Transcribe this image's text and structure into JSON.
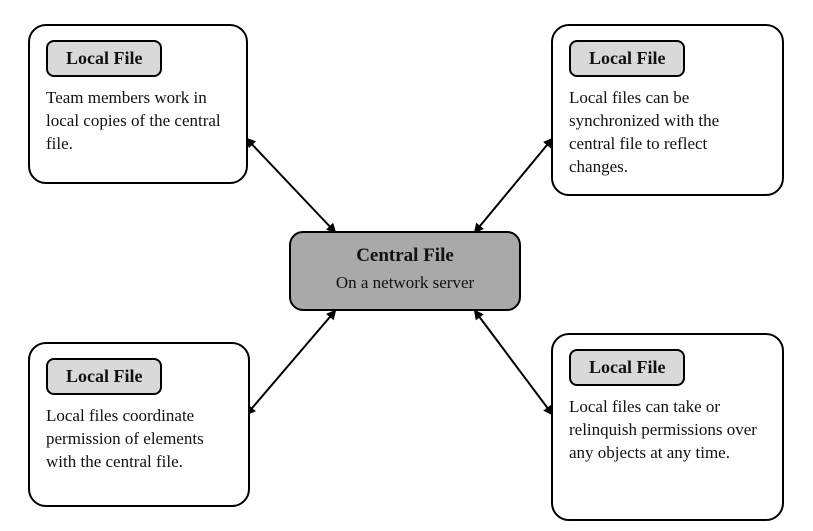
{
  "diagram": {
    "center": {
      "title": "Central File",
      "subtitle": "On a network server"
    },
    "nodes": {
      "tl": {
        "badge": "Local File",
        "desc": "Team members work in local copies of the central file."
      },
      "tr": {
        "badge": "Local File",
        "desc": "Local files can be synchronized with the central file to reflect changes."
      },
      "bl": {
        "badge": "Local File",
        "desc": "Local files coordinate permission of elements with the central file."
      },
      "br": {
        "badge": "Local File",
        "desc": "Local files can take or relinquish permissions over any objects at any time."
      }
    }
  }
}
